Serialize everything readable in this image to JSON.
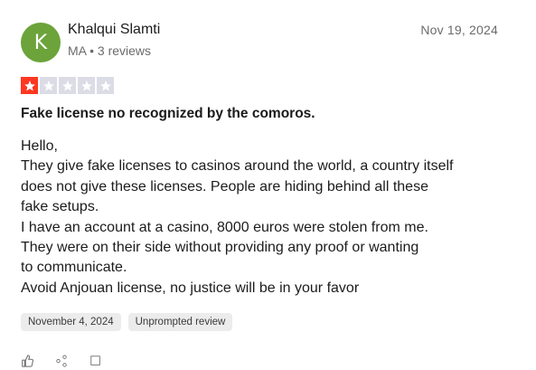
{
  "review": {
    "avatar_letter": "K",
    "avatar_color": "#6ca33a",
    "reviewer_name": "Khalqui Slamti",
    "reviewer_meta": "MA • 3 reviews",
    "posted_date": "Nov 19, 2024",
    "rating": 1,
    "rating_max": 5,
    "star_color_filled": "#ff3722",
    "star_color_empty": "#dcdce6",
    "title": "Fake license no recognized by the comoros.",
    "body_lines": [
      "Hello,",
      "They give fake licenses to casinos around the world, a country itself",
      "does not give these licenses. People are hiding behind all these",
      "fake setups.",
      "I have an account at a casino, 8000 euros were stolen from me.",
      "They were on their side without providing any proof or wanting",
      "to communicate.",
      "Avoid Anjouan license, no justice will be in your favor"
    ],
    "tags": [
      "November 4, 2024",
      "Unprompted review"
    ]
  }
}
